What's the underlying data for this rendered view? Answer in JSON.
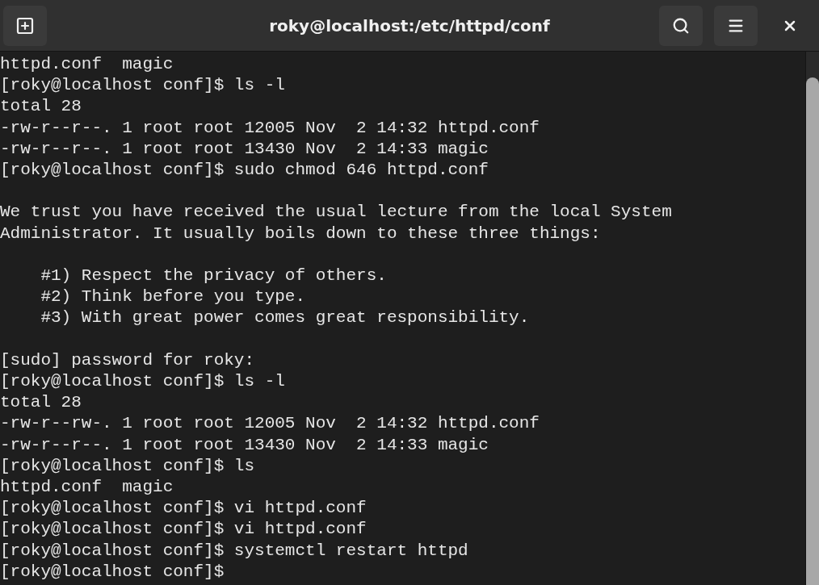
{
  "window": {
    "title": "roky@localhost:/etc/httpd/conf"
  },
  "terminal": {
    "blocks": [
      [
        "httpd.conf  magic",
        "[roky@localhost conf]$ ls -l",
        "total 28",
        "-rw-r--r--. 1 root root 12005 Nov  2 14:32 httpd.conf",
        "-rw-r--r--. 1 root root 13430 Nov  2 14:33 magic",
        "[roky@localhost conf]$ sudo chmod 646 httpd.conf"
      ],
      [
        "We trust you have received the usual lecture from the local System",
        "Administrator. It usually boils down to these three things:"
      ],
      [
        "    #1) Respect the privacy of others.",
        "    #2) Think before you type.",
        "    #3) With great power comes great responsibility."
      ],
      [
        "[sudo] password for roky:",
        "[roky@localhost conf]$ ls -l",
        "total 28",
        "-rw-r--rw-. 1 root root 12005 Nov  2 14:32 httpd.conf",
        "-rw-r--r--. 1 root root 13430 Nov  2 14:33 magic",
        "[roky@localhost conf]$ ls",
        "httpd.conf  magic",
        "[roky@localhost conf]$ vi httpd.conf",
        "[roky@localhost conf]$ vi httpd.conf",
        "[roky@localhost conf]$ systemctl restart httpd",
        "[roky@localhost conf]$"
      ]
    ]
  }
}
